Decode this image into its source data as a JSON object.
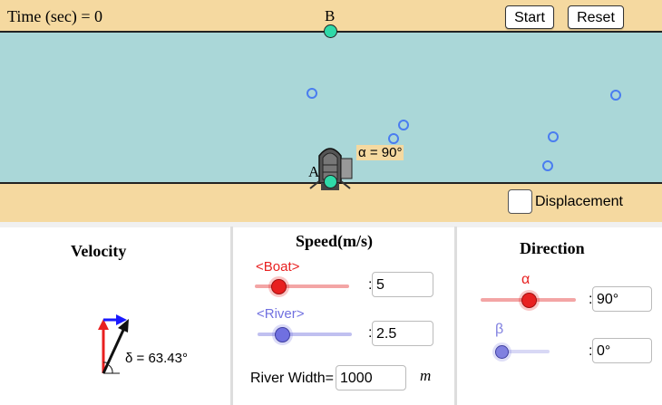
{
  "sim": {
    "time_label": "Time (sec) = 0",
    "point_b": "B",
    "point_a": "A",
    "alpha_label": "α = 90°",
    "displacement_label": "Displacement",
    "start_label": "Start",
    "reset_label": "Reset"
  },
  "velocity": {
    "title": "Velocity",
    "delta_label": "δ = 63.43°"
  },
  "speed": {
    "title": "Speed(m/s)",
    "boat_label": "<Boat>",
    "boat_value": "5",
    "river_label": "<River>",
    "river_value": "2.5",
    "river_width_label": "River Width=",
    "river_width_value": "1000",
    "river_width_unit": "m"
  },
  "direction": {
    "title": "Direction",
    "alpha_symbol": "α",
    "alpha_value": "90°",
    "beta_symbol": "β",
    "beta_value": "0°"
  },
  "colors": {
    "sand": "#f5d9a0",
    "water": "#aad7d8",
    "point": "#2fd9a8",
    "boat_slider": "#e83030",
    "river_slider": "#7070e0",
    "velocity_red": "#e82020",
    "velocity_blue": "#1a1aff"
  }
}
